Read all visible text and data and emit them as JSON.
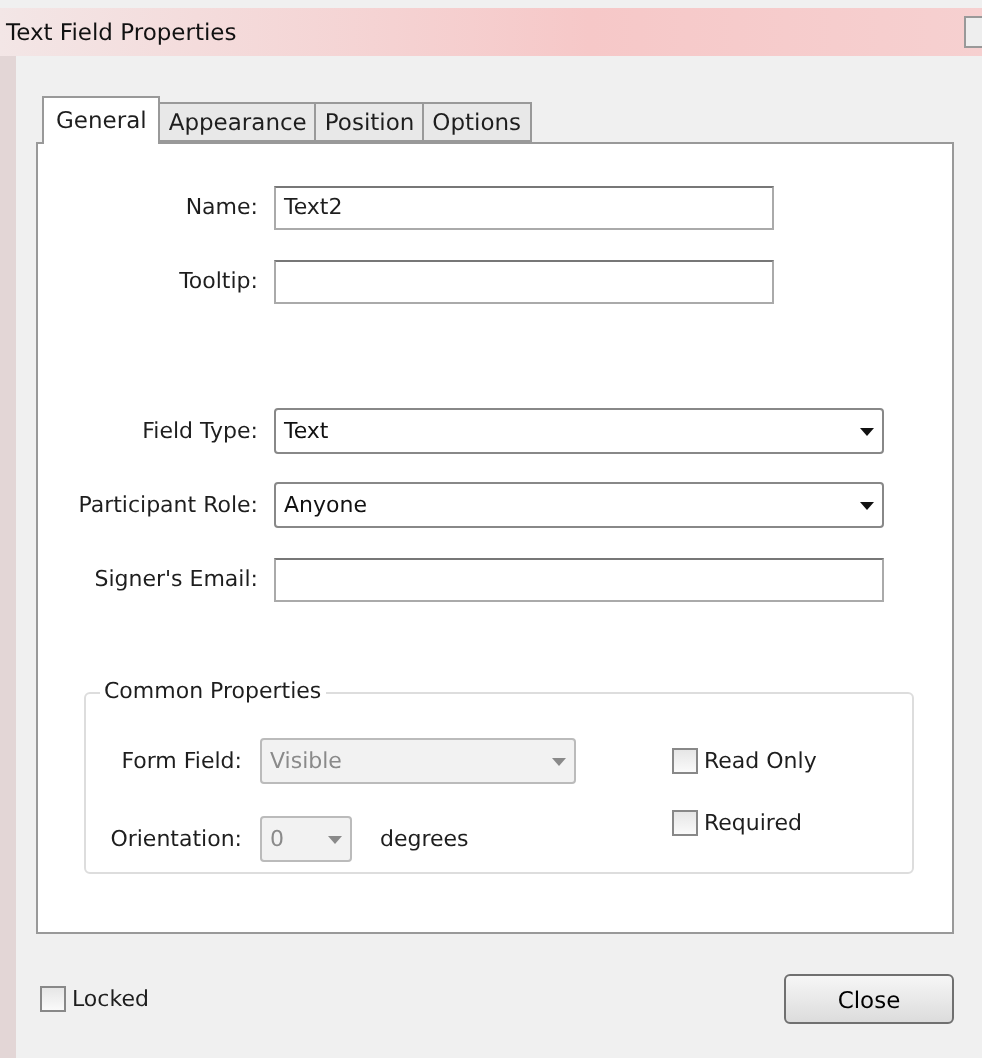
{
  "window": {
    "title": "Text Field Properties"
  },
  "tabs": [
    {
      "label": "General",
      "selected": true
    },
    {
      "label": "Appearance",
      "selected": false
    },
    {
      "label": "Position",
      "selected": false
    },
    {
      "label": "Options",
      "selected": false
    }
  ],
  "name_fields": [
    {
      "kind": "text",
      "label": "Name:",
      "value": "Text2"
    },
    {
      "kind": "text",
      "label": "Tooltip:"
    }
  ],
  "role_fields": [
    {
      "kind": "select",
      "label": "Field Type:",
      "value": "Text"
    },
    {
      "kind": "select",
      "label": "Participant Role:",
      "value": "Anyone"
    },
    {
      "kind": "text",
      "label": "Signer's Email:"
    }
  ],
  "common_properties": {
    "title": "Common Properties",
    "form_field": {
      "label": "Form Field:",
      "value": "Visible",
      "disabled": true
    },
    "orientation": {
      "label": "Orientation:",
      "value": "0",
      "unit": "degrees",
      "disabled": true
    },
    "checkboxes": [
      {
        "label": "Read Only",
        "checked": false
      },
      {
        "label": "Required",
        "checked": false
      }
    ]
  },
  "locked": {
    "label": "Locked",
    "checked": false
  },
  "buttons": [
    "Close"
  ]
}
